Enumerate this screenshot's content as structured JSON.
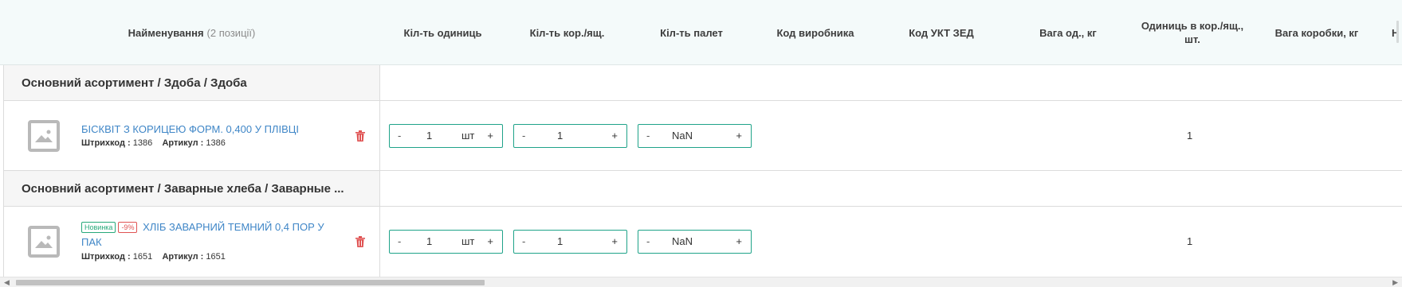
{
  "header": {
    "name_label": "Найменування",
    "name_count": "(2 позиції)",
    "columns": [
      "Кіл-ть одиниць",
      "Кіл-ть кор./ящ.",
      "Кіл-ть палет",
      "Код виробника",
      "Код УКТ ЗЕД",
      "Вага од., кг",
      "Одиниць в кор./ящ., шт.",
      "Вага коробки, кг",
      "Н"
    ]
  },
  "groups": [
    {
      "title": "Основний асортимент / Здоба / Здоба"
    },
    {
      "title": "Основний асортимент / Заварные хлеба / Заварные ..."
    }
  ],
  "items": [
    {
      "name": "БІСКВІТ З КОРИЦЕЮ ФОРМ. 0,400 У ПЛІВЦІ",
      "barcode_label": "Штрихкод :",
      "barcode": "1386",
      "article_label": "Артикул :",
      "article": "1386",
      "qty_units": {
        "minus": "-",
        "value": "1",
        "unit": "шт",
        "plus": "+"
      },
      "qty_boxes": {
        "minus": "-",
        "value": "1",
        "plus": "+"
      },
      "qty_pallets": {
        "minus": "-",
        "value": "NaN",
        "plus": "+"
      },
      "units_per_box": "1"
    },
    {
      "badge_new": "Новинка",
      "badge_sale": "-9%",
      "name": "ХЛІБ ЗАВАРНИЙ ТЕМНИЙ 0,4 ПОР У ПАК",
      "barcode_label": "Штрихкод :",
      "barcode": "1651",
      "article_label": "Артикул :",
      "article": "1651",
      "qty_units": {
        "minus": "-",
        "value": "1",
        "unit": "шт",
        "plus": "+"
      },
      "qty_boxes": {
        "minus": "-",
        "value": "1",
        "plus": "+"
      },
      "qty_pallets": {
        "minus": "-",
        "value": "NaN",
        "plus": "+"
      },
      "units_per_box": "1"
    }
  ],
  "colors": {
    "accent": "#1fa389",
    "link": "#3f86c7",
    "danger": "#e05353"
  },
  "icons": {
    "thumbnail": "image-placeholder-icon",
    "delete": "trash-icon"
  }
}
